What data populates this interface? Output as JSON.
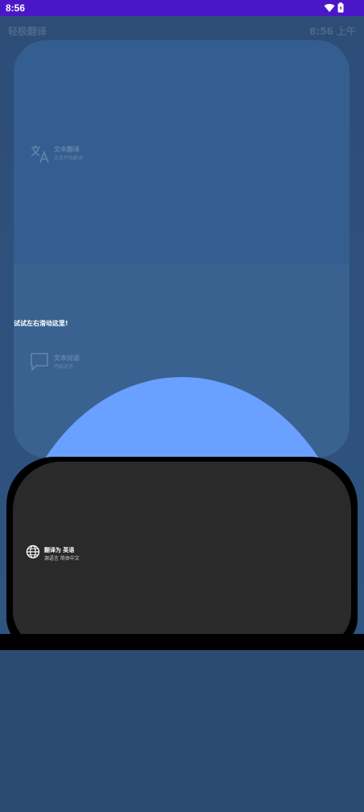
{
  "status_bar": {
    "time": "8:56",
    "icons": [
      "wifi-icon",
      "battery-icon"
    ]
  },
  "app": {
    "title": "轻极翻译",
    "clock": "8:56 上午"
  },
  "features": [
    {
      "icon": "translate-icon",
      "title": "文本翻译",
      "subtitle": "点击开始翻译"
    },
    {
      "icon": "chat-icon",
      "title": "文本对话",
      "subtitle": "开始对话"
    }
  ],
  "hint": "试试左右滑动这里!",
  "translate_target": {
    "icon": "globe-icon",
    "title": "翻译为 英语",
    "subtitle": "源语言 简体中文"
  },
  "colors": {
    "status_bar": "#4a17c8",
    "background": "#2a4a72",
    "dome": "#6aa0ff",
    "pad": "#2a2a2a"
  }
}
